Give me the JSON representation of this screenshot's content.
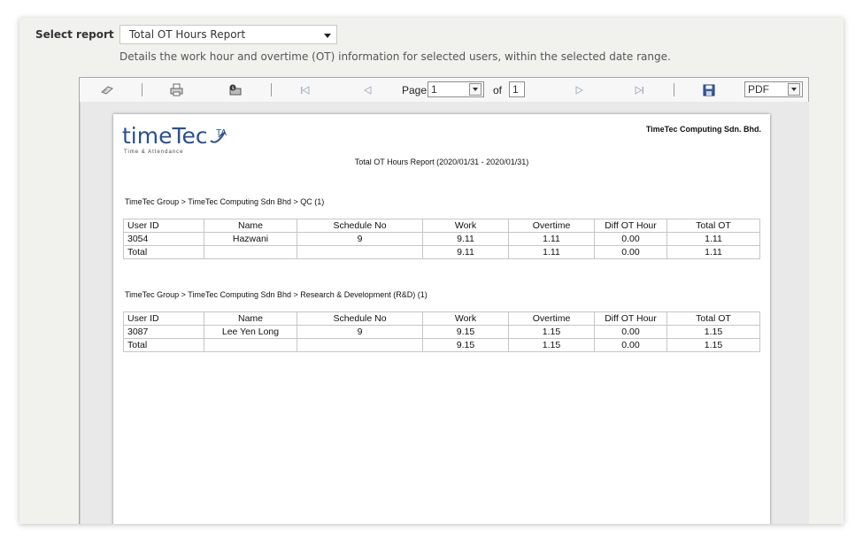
{
  "select_report": {
    "label": "Select report",
    "selected": "Total OT Hours Report",
    "description": "Details the work hour and overtime (OT) information for selected users, within the selected date range."
  },
  "toolbar": {
    "page_label": "Page",
    "page_value": "1",
    "of_label": "of",
    "total_pages": "1",
    "format": "PDF",
    "icons": [
      "refresh-icon",
      "print-icon",
      "export-icon",
      "first-page-icon",
      "previous-page-icon",
      "next-page-icon",
      "last-page-icon",
      "save-icon"
    ]
  },
  "report": {
    "logo": {
      "text_a": "time",
      "text_b": "Tec",
      "ta": "TA",
      "tagline": "Time & Attendance"
    },
    "company": "TimeTec Computing Sdn. Bhd.",
    "title": "Total OT Hours Report (2020/01/31 - 2020/01/31)",
    "headers": [
      "User ID",
      "Name",
      "Schedule No",
      "Work",
      "Overtime",
      "Diff OT Hour",
      "Total OT"
    ],
    "groups": [
      {
        "path": "TimeTec Group > TimeTec Computing Sdn Bhd > QC  (1)",
        "rows": [
          [
            "3054",
            "Hazwani",
            "9",
            "9.11",
            "1.11",
            "0.00",
            "1.11"
          ],
          [
            "Total",
            "",
            "",
            "9.11",
            "1.11",
            "0.00",
            "1.11"
          ]
        ]
      },
      {
        "path": "TimeTec Group > TimeTec Computing Sdn Bhd > Research & Development (R&D)  (1)",
        "rows": [
          [
            "3087",
            "Lee Yen Long",
            "9",
            "9.15",
            "1.15",
            "0.00",
            "1.15"
          ],
          [
            "Total",
            "",
            "",
            "9.15",
            "1.15",
            "0.00",
            "1.15"
          ]
        ]
      }
    ]
  }
}
